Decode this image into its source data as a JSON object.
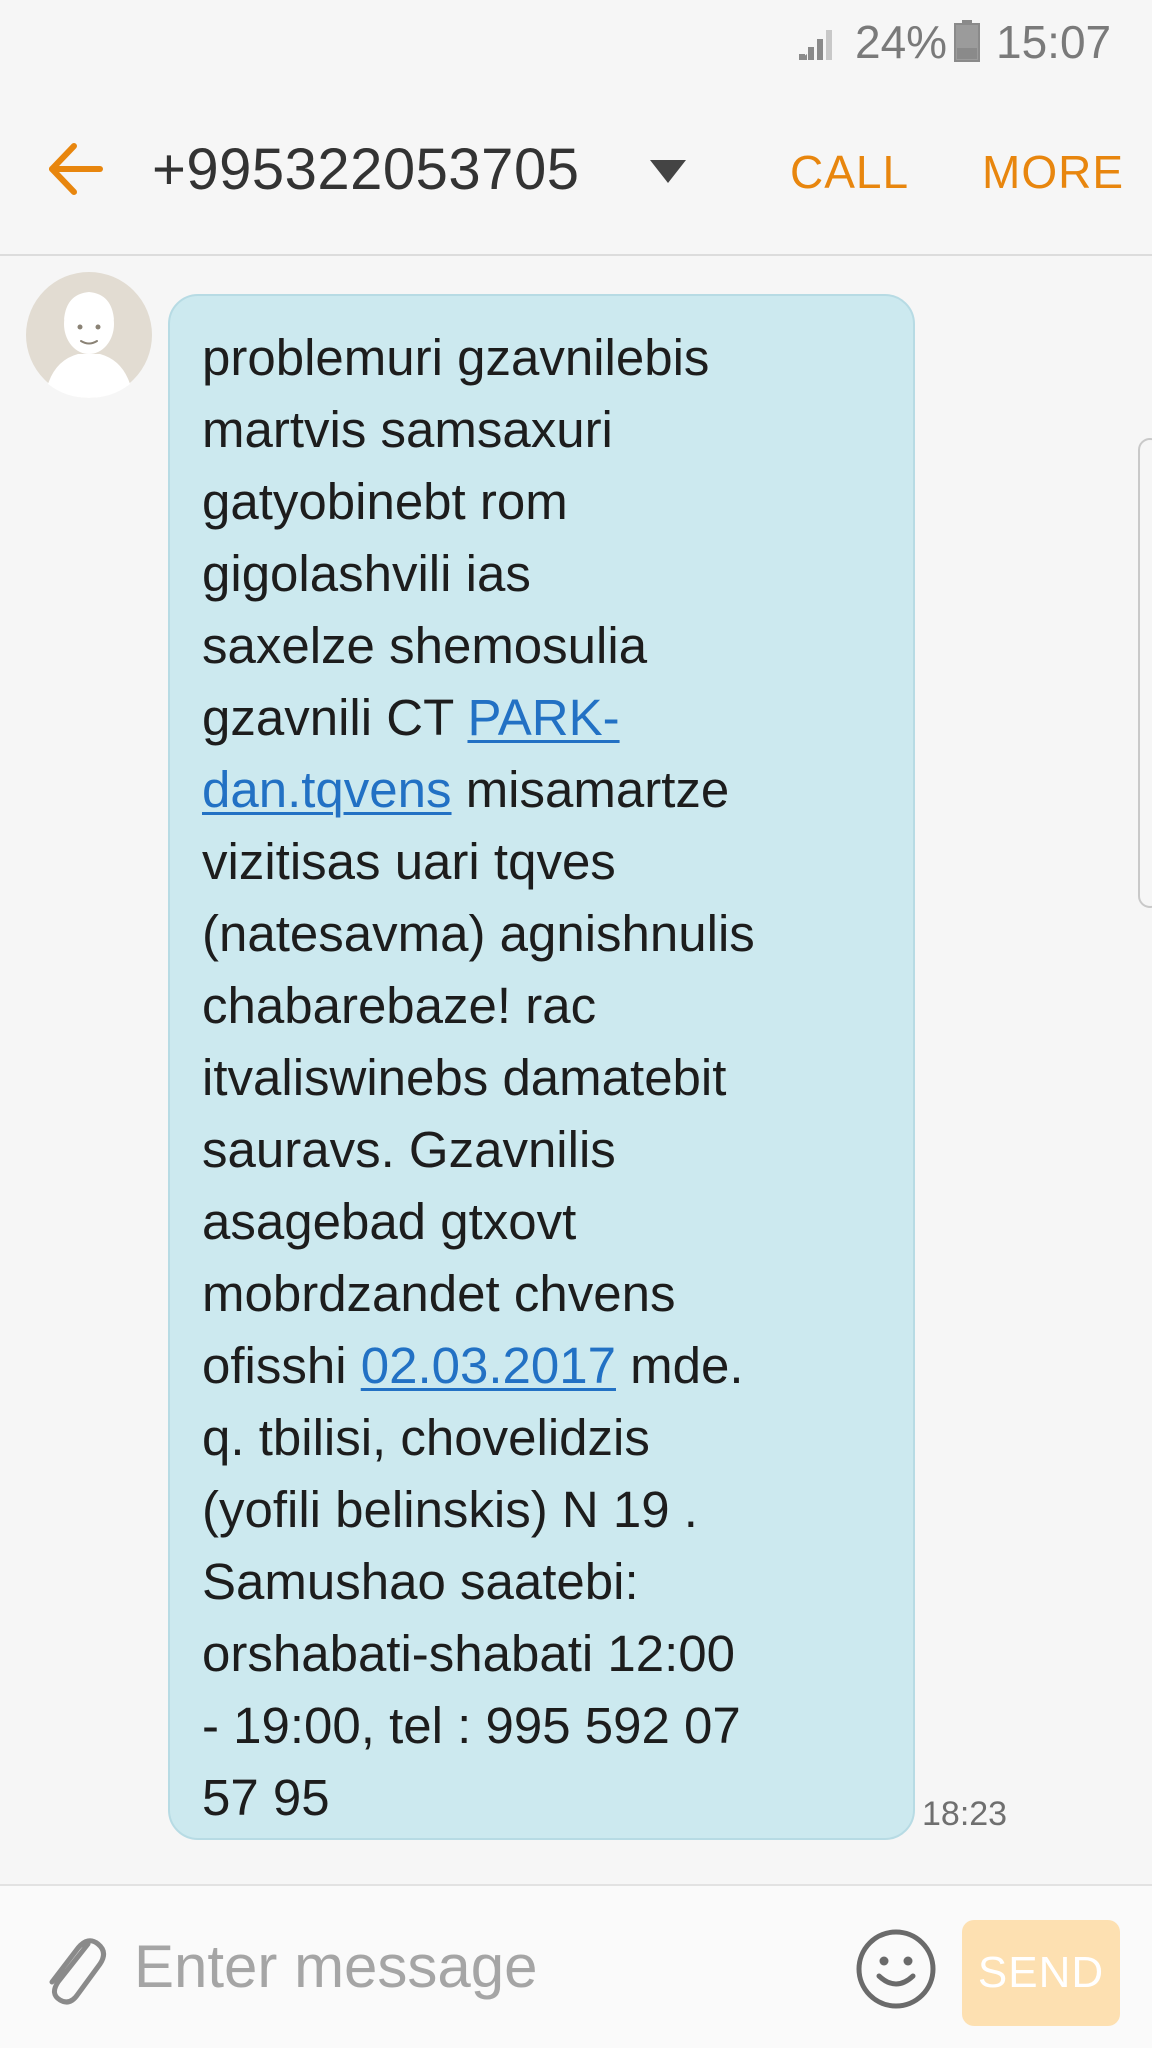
{
  "status_bar": {
    "battery_percent": "24%",
    "time": "15:07",
    "signal_icon": "signal-icon",
    "battery_icon": "battery-icon"
  },
  "header": {
    "back_icon": "arrow-left-icon",
    "contact_number": "+995322053705",
    "dropdown_icon": "triangle-down-icon",
    "call_label": "CALL",
    "more_label": "MORE"
  },
  "message": {
    "lines": [
      {
        "parts": [
          {
            "text": "problemuri gzavnilebis"
          }
        ]
      },
      {
        "parts": [
          {
            "text": "martvis samsaxuri"
          }
        ]
      },
      {
        "parts": [
          {
            "text": "gatyobinebt rom"
          }
        ]
      },
      {
        "parts": [
          {
            "text": "gigolashvili ias"
          }
        ]
      },
      {
        "parts": [
          {
            "text": "saxelze shemosulia"
          }
        ]
      },
      {
        "parts": [
          {
            "text": "gzavnili CT "
          },
          {
            "text": "PARK-",
            "link": true
          }
        ]
      },
      {
        "parts": [
          {
            "text": "dan.tqvens",
            "link": true
          },
          {
            "text": " misamartze"
          }
        ]
      },
      {
        "parts": [
          {
            "text": "vizitisas uari tqves"
          }
        ]
      },
      {
        "parts": [
          {
            "text": "(natesavma) agnishnulis"
          }
        ]
      },
      {
        "parts": [
          {
            "text": "chabarebaze! rac"
          }
        ]
      },
      {
        "parts": [
          {
            "text": "itvaliswinebs damatebit"
          }
        ]
      },
      {
        "parts": [
          {
            "text": "sauravs. Gzavnilis"
          }
        ]
      },
      {
        "parts": [
          {
            "text": "asagebad gtxovt"
          }
        ]
      },
      {
        "parts": [
          {
            "text": "mobrdzandet chvens"
          }
        ]
      },
      {
        "parts": [
          {
            "text": "ofisshi "
          },
          {
            "text": "02.03.2017",
            "link": true
          },
          {
            "text": " mde."
          }
        ]
      },
      {
        "parts": [
          {
            "text": "q. tbilisi, chovelidzis"
          }
        ]
      },
      {
        "parts": [
          {
            "text": "(yofili belinskis) N 19 ."
          }
        ]
      },
      {
        "parts": [
          {
            "text": "Samushao saatebi:"
          }
        ]
      },
      {
        "parts": [
          {
            "text": "orshabati-shabati 12:00"
          }
        ]
      },
      {
        "parts": [
          {
            "text": "- 19:00, tel :  995 592 07"
          }
        ]
      },
      {
        "parts": [
          {
            "text": "57 95"
          }
        ]
      }
    ],
    "time": "18:23",
    "avatar_icon": "default-avatar-icon"
  },
  "compose": {
    "attach_icon": "paperclip-icon",
    "placeholder": "Enter message",
    "value": "",
    "emoji_icon": "smiley-icon",
    "send_label": "SEND"
  },
  "colors": {
    "accent": "#e8860e",
    "bubble": "#cce9ef",
    "link": "#2271c4",
    "send_disabled": "#fde0b1"
  }
}
